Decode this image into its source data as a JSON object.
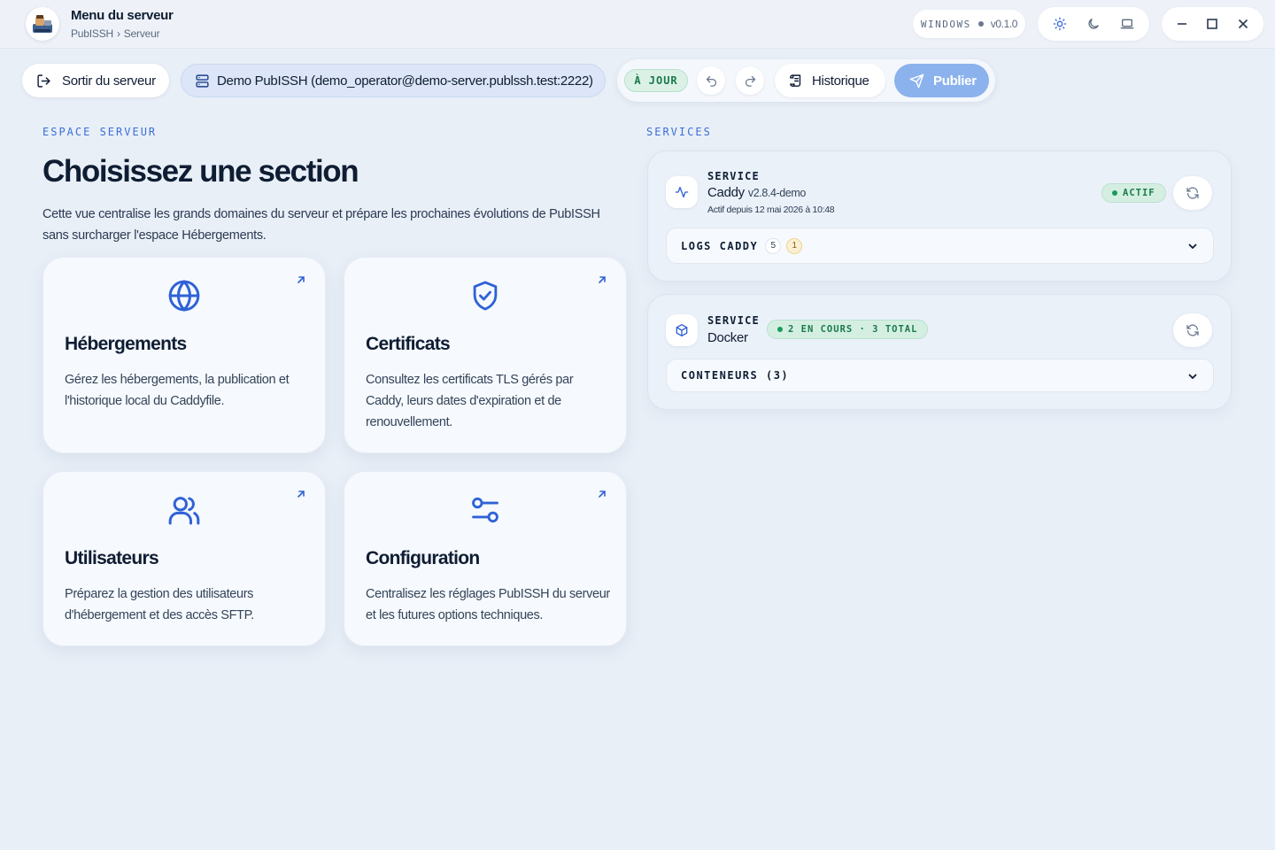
{
  "window": {
    "title": "Menu du serveur",
    "breadcrumb": [
      "PubISSH",
      "Serveur"
    ],
    "breadcrumb_sep": "›",
    "platform": "WINDOWS",
    "version": "v0.1.0"
  },
  "toolbar": {
    "exit_label": "Sortir du serveur",
    "server_label": "Demo PubISSH (demo_operator@demo-server.publssh.test:2222)",
    "status_badge": "À JOUR",
    "history_label": "Historique",
    "publish_label": "Publier"
  },
  "server_space": {
    "eyebrow": "ESPACE SERVEUR",
    "title": "Choisissez une section",
    "description": "Cette vue centralise les grands domaines du serveur et prépare les prochaines évolutions de PubISSH sans surcharger l'espace Hébergements.",
    "cards": [
      {
        "icon": "globe-icon",
        "title": "Hébergements",
        "description": "Gérez les hébergements, la publication et l'historique local du Caddyfile."
      },
      {
        "icon": "shield-check-icon",
        "title": "Certificats",
        "description": "Consultez les certificats TLS gérés par Caddy, leurs dates d'expiration et de renouvellement."
      },
      {
        "icon": "users-icon",
        "title": "Utilisateurs",
        "description": "Préparez la gestion des utilisateurs d'hébergement et des accès SFTP."
      },
      {
        "icon": "settings-sliders-icon",
        "title": "Configuration",
        "description": "Centralisez les réglages PubISSH du serveur et les futures options techniques."
      }
    ]
  },
  "services": {
    "eyebrow": "SERVICES",
    "caddy": {
      "label": "SERVICE",
      "name": "Caddy",
      "version": "v2.8.4-demo",
      "since": "Actif depuis 12 mai 2026 à 10:48",
      "status": "ACTIF",
      "logs_label": "LOGS CADDY",
      "logs_count": "5",
      "logs_warn_count": "1"
    },
    "docker": {
      "label": "SERVICE",
      "name": "Docker",
      "status": "2 EN COURS · 3 TOTAL",
      "containers_label": "CONTENEURS (3)"
    }
  },
  "colors": {
    "accent": "#2f62d6",
    "background": "#e9eff7",
    "success": "#1a7a4c",
    "publish": "#8bb2ec"
  }
}
